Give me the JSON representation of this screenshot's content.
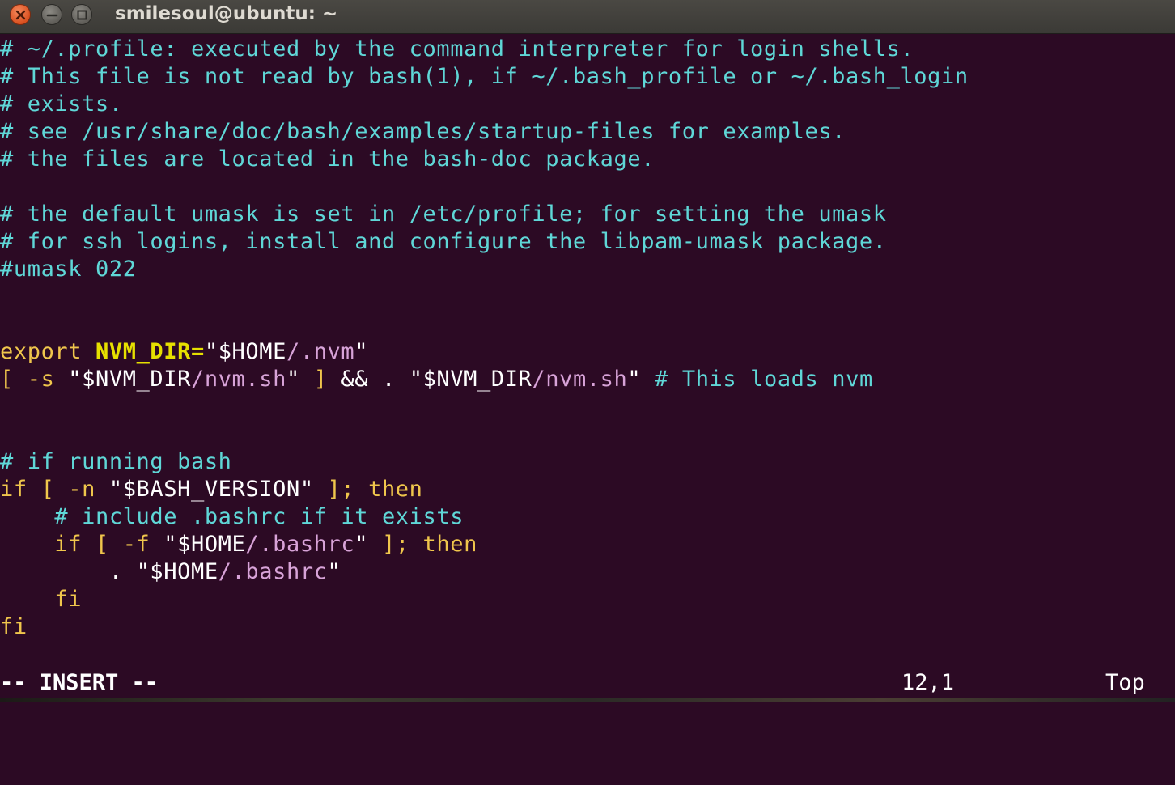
{
  "window": {
    "title": "smilesoul@ubuntu: ~"
  },
  "editor": {
    "lines": [
      [
        {
          "t": "# ~/.profile: executed by the command interpreter for login shells.",
          "c": "comment"
        }
      ],
      [
        {
          "t": "# This file is not read by bash(1), if ~/.bash_profile or ~/.bash_login",
          "c": "comment"
        }
      ],
      [
        {
          "t": "# exists.",
          "c": "comment"
        }
      ],
      [
        {
          "t": "# see /usr/share/doc/bash/examples/startup-files for examples.",
          "c": "comment"
        }
      ],
      [
        {
          "t": "# the files are located in the bash-doc package.",
          "c": "comment"
        }
      ],
      [],
      [
        {
          "t": "# the default umask is set in /etc/profile; for setting the umask",
          "c": "comment"
        }
      ],
      [
        {
          "t": "# for ssh logins, install and configure the libpam-umask package.",
          "c": "comment"
        }
      ],
      [
        {
          "t": "#umask 022",
          "c": "comment"
        }
      ],
      [],
      [],
      [
        {
          "t": "export ",
          "c": "keyword"
        },
        {
          "t": "NVM_DIR=",
          "c": "ident"
        },
        {
          "t": "\"$HOME",
          "c": "text"
        },
        {
          "t": "/.nvm",
          "c": "string"
        },
        {
          "t": "\"",
          "c": "text"
        }
      ],
      [
        {
          "t": "[ -s ",
          "c": "keyword"
        },
        {
          "t": "\"$NVM_DIR",
          "c": "text"
        },
        {
          "t": "/nvm.sh",
          "c": "string"
        },
        {
          "t": "\" ",
          "c": "text"
        },
        {
          "t": "] ",
          "c": "keyword"
        },
        {
          "t": "&& . ",
          "c": "text"
        },
        {
          "t": "\"$NVM_DIR",
          "c": "text"
        },
        {
          "t": "/nvm.sh",
          "c": "string"
        },
        {
          "t": "\" ",
          "c": "text"
        },
        {
          "t": "# This loads nvm",
          "c": "comment"
        }
      ],
      [],
      [],
      [
        {
          "t": "# if running bash",
          "c": "comment"
        }
      ],
      [
        {
          "t": "if [ -n ",
          "c": "keyword"
        },
        {
          "t": "\"$BASH_VERSION\" ",
          "c": "text"
        },
        {
          "t": "]; then",
          "c": "keyword"
        }
      ],
      [
        {
          "t": "    ",
          "c": "text"
        },
        {
          "t": "# include .bashrc if it exists",
          "c": "comment"
        }
      ],
      [
        {
          "t": "    ",
          "c": "text"
        },
        {
          "t": "if [ -f ",
          "c": "keyword"
        },
        {
          "t": "\"$HOME",
          "c": "text"
        },
        {
          "t": "/.bashrc",
          "c": "string"
        },
        {
          "t": "\" ",
          "c": "text"
        },
        {
          "t": "]; then",
          "c": "keyword"
        }
      ],
      [
        {
          "t": "        . ",
          "c": "text"
        },
        {
          "t": "\"$HOME",
          "c": "text"
        },
        {
          "t": "/.bashrc",
          "c": "string"
        },
        {
          "t": "\"",
          "c": "text"
        }
      ],
      [
        {
          "t": "    ",
          "c": "text"
        },
        {
          "t": "fi",
          "c": "keyword"
        }
      ],
      [
        {
          "t": "fi",
          "c": "keyword"
        }
      ]
    ]
  },
  "statusline": {
    "mode": "-- INSERT --",
    "ruler": "12,1",
    "position": "Top"
  },
  "colors": {
    "background": "#2c0a24",
    "comment": "#5fd7d7",
    "keyword": "#f0c64c",
    "identifier": "#e6e000",
    "string": "#d8a3d8"
  }
}
